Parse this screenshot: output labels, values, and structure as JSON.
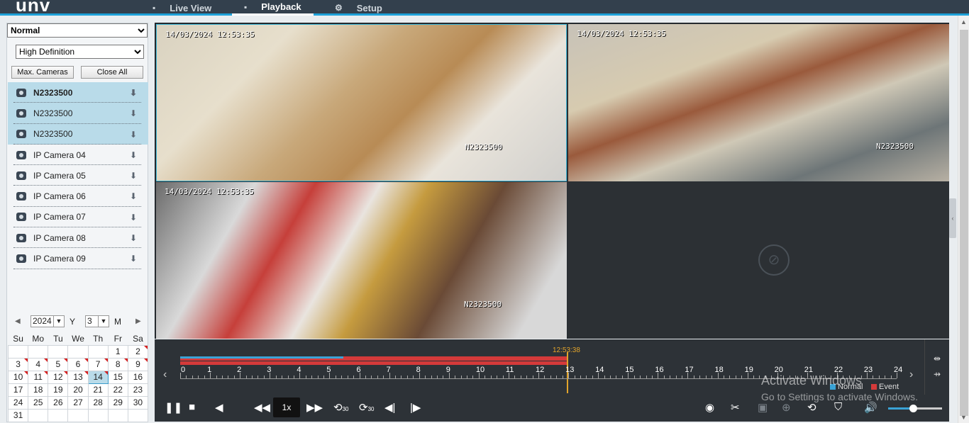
{
  "app": {
    "logo": "unv"
  },
  "nav": {
    "live_view": "Live View",
    "playback": "Playback",
    "setup": "Setup"
  },
  "left": {
    "mode": "Normal",
    "definition": "High Definition",
    "max_cameras": "Max. Cameras",
    "close_all": "Close All",
    "cameras": [
      {
        "name": "N2323500",
        "selected": true
      },
      {
        "name": "N2323500",
        "selected": true
      },
      {
        "name": "N2323500",
        "selected": true
      },
      {
        "name": "IP Camera 04",
        "selected": false
      },
      {
        "name": "IP Camera 05",
        "selected": false
      },
      {
        "name": "IP Camera 06",
        "selected": false
      },
      {
        "name": "IP Camera 07",
        "selected": false
      },
      {
        "name": "IP Camera 08",
        "selected": false
      },
      {
        "name": "IP Camera 09",
        "selected": false
      }
    ]
  },
  "calendar": {
    "year": "2024",
    "year_label": "Y",
    "month": "3",
    "month_label": "M",
    "weekdays": [
      "Su",
      "Mo",
      "Tu",
      "We",
      "Th",
      "Fr",
      "Sa"
    ],
    "weeks": [
      [
        "",
        "",
        "",
        "",
        "",
        "1",
        "2"
      ],
      [
        "3",
        "4",
        "5",
        "6",
        "7",
        "8",
        "9"
      ],
      [
        "10",
        "11",
        "12",
        "13",
        "14",
        "15",
        "16"
      ],
      [
        "17",
        "18",
        "19",
        "20",
        "21",
        "22",
        "23"
      ],
      [
        "24",
        "25",
        "26",
        "27",
        "28",
        "29",
        "30"
      ],
      [
        "31",
        "",
        "",
        "",
        "",
        "",
        ""
      ]
    ],
    "recorded_days": [
      "2",
      "3",
      "4",
      "5",
      "6",
      "7",
      "8",
      "9",
      "10",
      "11",
      "12",
      "13",
      "14"
    ],
    "selected_day": "14"
  },
  "tiles": [
    {
      "timestamp": "14/03/2024 12:53:35",
      "overlay_name": "N2323500"
    },
    {
      "timestamp": "14/03/2024 12:53:35",
      "overlay_name": "N2323500"
    },
    {
      "timestamp": "14/03/2024 12:53:35",
      "overlay_name": "N2323500"
    }
  ],
  "timeline": {
    "cursor_time": "12:53:38",
    "hours": [
      "0",
      "1",
      "2",
      "3",
      "4",
      "5",
      "6",
      "7",
      "8",
      "9",
      "10",
      "11",
      "12",
      "13",
      "14",
      "15",
      "16",
      "17",
      "18",
      "19",
      "20",
      "21",
      "22",
      "23",
      "24"
    ],
    "legend_normal": "Normal",
    "legend_event": "Event",
    "normal_color": "#3aa3d6",
    "event_color": "#d43a3a"
  },
  "controls": {
    "speed": "1x",
    "skip_back": "30",
    "skip_fwd": "30"
  },
  "watermark": {
    "line1": "Activate Windows",
    "line2": "Go to Settings to activate Windows."
  }
}
